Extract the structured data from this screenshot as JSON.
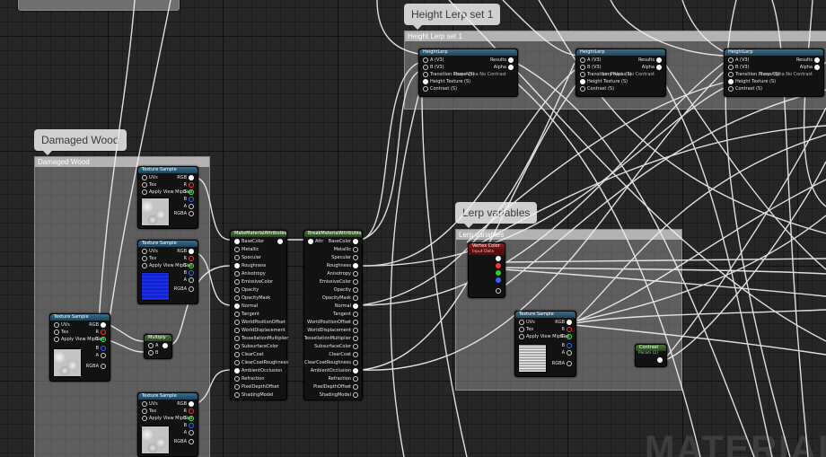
{
  "watermark": "MATERIAL",
  "comments": {
    "height_lerp": {
      "bubble": "Height Lerp set 1",
      "header": "Height Lerp set 1"
    },
    "damaged_wood": {
      "bubble": "Damaged Wood",
      "header": "Damaged Wood"
    },
    "lerp_variables": {
      "bubble": "Lerp variables",
      "header": "Lerp variables"
    }
  },
  "texture_sample": {
    "title": "Texture Sample",
    "in_uvs": "UVs",
    "in_tex": "Tex",
    "in_mip": "Apply View MipBias",
    "out_rgb": "RGB",
    "out_r": "R",
    "out_g": "G",
    "out_b": "B",
    "out_a": "A",
    "out_rgba": "RGBA"
  },
  "multiply": {
    "title": "Multiply",
    "a": "A",
    "b": "B"
  },
  "make_material": {
    "title": "MakeMaterialAttributes",
    "pins": [
      "BaseColor",
      "Metallic",
      "Specular",
      "Roughness",
      "Anisotropy",
      "EmissiveColor",
      "Opacity",
      "OpacityMask",
      "Normal",
      "Tangent",
      "WorldPositionOffset",
      "WorldDisplacement",
      "TessellationMultiplier",
      "SubsurfaceColor",
      "ClearCoat",
      "ClearCoatRoughness",
      "AmbientOcclusion",
      "Refraction",
      "PixelDepthOffset",
      "ShadingModel"
    ]
  },
  "break_material": {
    "title": "BreakMaterialAttributes",
    "input": "Attr",
    "pins": [
      "BaseColor",
      "Metallic",
      "Specular",
      "Roughness",
      "Anisotropy",
      "EmissiveColor",
      "Opacity",
      "OpacityMask",
      "Normal",
      "Tangent",
      "WorldPositionOffset",
      "WorldDisplacement",
      "TessellationMultiplier",
      "SubsurfaceColor",
      "ClearCoat",
      "ClearCoatRoughness",
      "AmbientOcclusion",
      "Refraction",
      "PixelDepthOffset",
      "ShadingModel"
    ]
  },
  "height_lerp_node": {
    "title": "HeightLerp",
    "in_a": "A (V3)",
    "in_b": "B (V3)",
    "in_transition": "Transition Phase (S)",
    "in_height": "Height Texture (S)",
    "in_contrast": "Contrast (S)",
    "out_results": "Results",
    "out_alpha": "Alpha",
    "default_label": "Lerp Alpha No Contrast"
  },
  "vertex_color": {
    "title": "Vertex Color",
    "subtitle": "Input Data"
  },
  "contrast": {
    "title": "Contrast",
    "subtitle": "Param (1)"
  }
}
